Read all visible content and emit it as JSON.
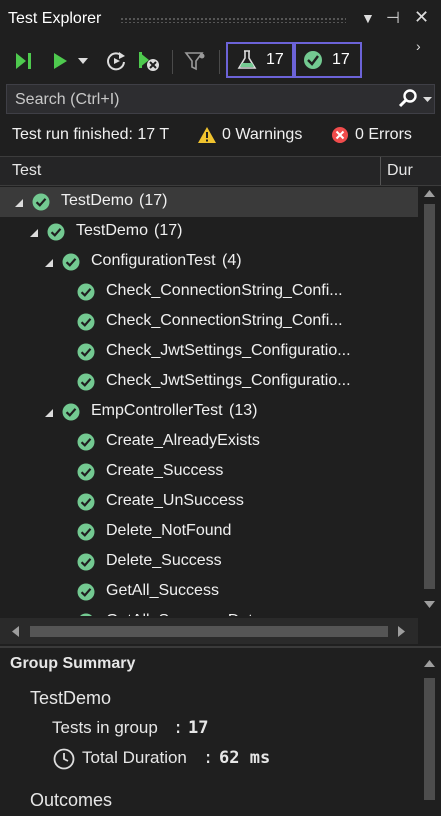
{
  "window": {
    "title": "Test Explorer"
  },
  "toolbar": {
    "flask_count": "17",
    "passed_count": "17"
  },
  "search": {
    "placeholder": "Search (Ctrl+I)"
  },
  "status": {
    "run_text": "Test run finished: 17 T",
    "warnings": "0 Warnings",
    "errors": "0 Errors"
  },
  "columns": {
    "test": "Test",
    "duration": "Dur"
  },
  "tree": [
    {
      "label": "TestDemo",
      "count": "(17)"
    },
    {
      "label": "TestDemo",
      "count": "(17)"
    },
    {
      "label": "ConfigurationTest",
      "count": "(4)"
    },
    {
      "label": "Check_ConnectionString_Confi..."
    },
    {
      "label": "Check_ConnectionString_Confi..."
    },
    {
      "label": "Check_JwtSettings_Configuratio..."
    },
    {
      "label": "Check_JwtSettings_Configuratio..."
    },
    {
      "label": "EmpControllerTest",
      "count": "(13)"
    },
    {
      "label": "Create_AlreadyExists"
    },
    {
      "label": "Create_Success"
    },
    {
      "label": "Create_UnSuccess"
    },
    {
      "label": "Delete_NotFound"
    },
    {
      "label": "Delete_Success"
    },
    {
      "label": "GetAll_Success"
    },
    {
      "label": "GetAll_Success_Data..."
    }
  ],
  "summary": {
    "heading": "Group Summary",
    "group_name": "TestDemo",
    "tests_label": "Tests in group",
    "tests_value": "17",
    "duration_label": "Total Duration",
    "duration_value": "62 ms",
    "outcomes": "Outcomes"
  },
  "colors": {
    "pass": "#73c991",
    "accent_border": "#6c63d8",
    "toolbar_green": "#4ec94e"
  }
}
